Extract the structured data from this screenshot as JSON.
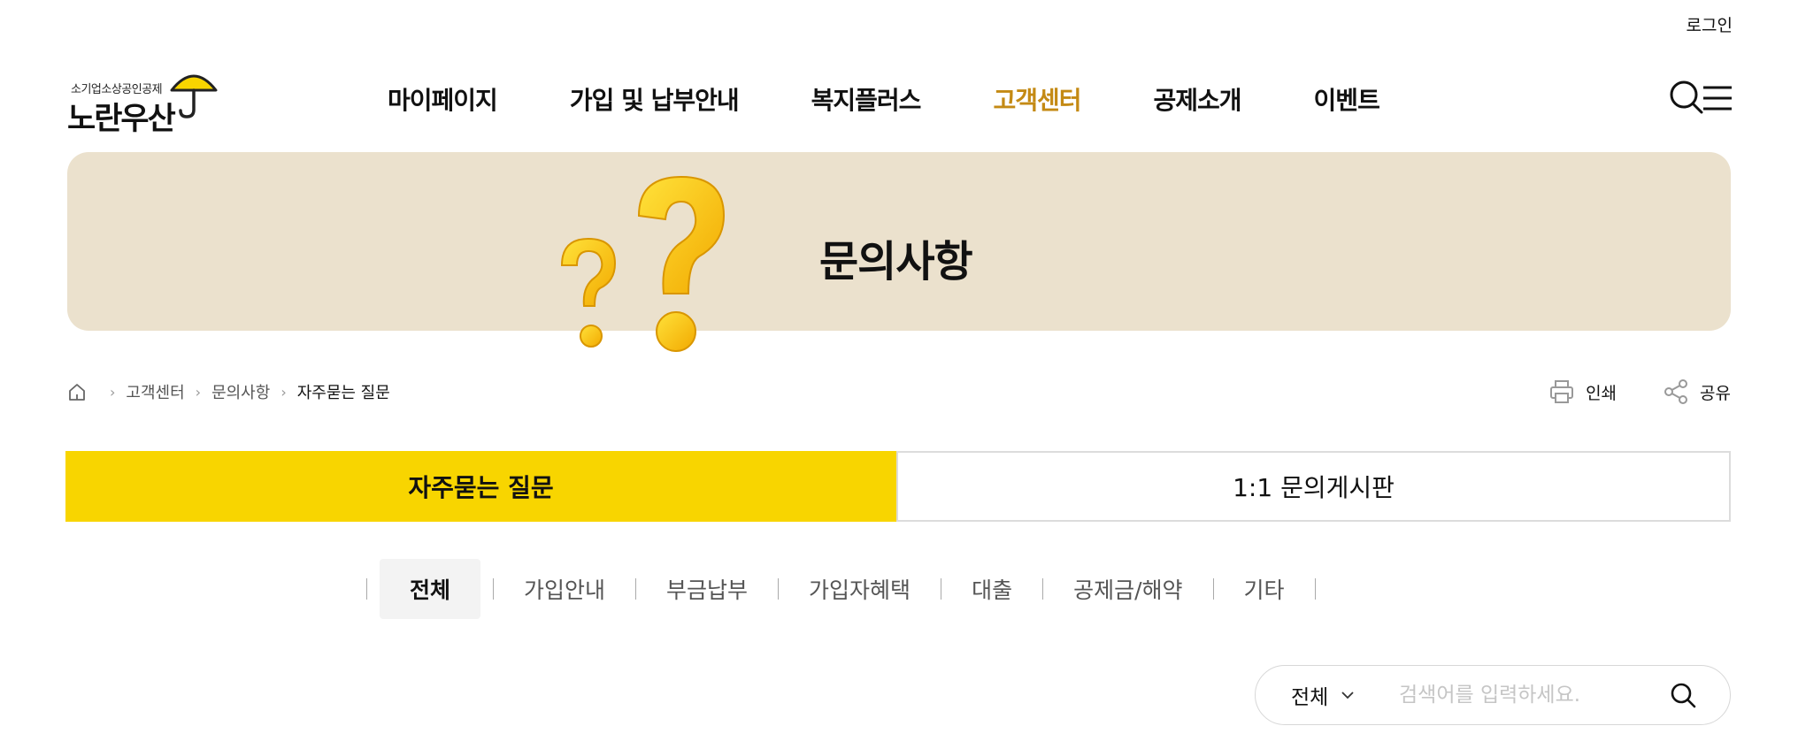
{
  "top_util": {
    "login_label": "로그인"
  },
  "logo": {
    "sub": "소기업소상공인공제",
    "main": "노란우산"
  },
  "gnb": {
    "items": [
      {
        "label": "마이페이지"
      },
      {
        "label": "가입 및 납부안내"
      },
      {
        "label": "복지플러스"
      },
      {
        "label": "고객센터",
        "active": true
      },
      {
        "label": "공제소개"
      },
      {
        "label": "이벤트"
      }
    ]
  },
  "banner": {
    "title": "문의사항"
  },
  "breadcrumb": {
    "items": [
      "고객센터",
      "문의사항",
      "자주묻는 질문"
    ]
  },
  "tools": {
    "print_label": "인쇄",
    "share_label": "공유"
  },
  "tabs": [
    {
      "label": "자주묻는 질문",
      "active": true
    },
    {
      "label": "1:1 문의게시판",
      "active": false
    }
  ],
  "categories": [
    {
      "label": "전체",
      "active": true
    },
    {
      "label": "가입안내"
    },
    {
      "label": "부금납부"
    },
    {
      "label": "가입자혜택"
    },
    {
      "label": "대출"
    },
    {
      "label": "공제금/해약"
    },
    {
      "label": "기타"
    }
  ],
  "search": {
    "select_value": "전체",
    "placeholder": "검색어를 입력하세요."
  },
  "colors": {
    "accent_yellow": "#f8d500",
    "active_nav": "#c48a14",
    "banner_bg": "#ebe1cd"
  },
  "icons": [
    "home-icon",
    "chevron-right-icon",
    "print-icon",
    "share-icon",
    "search-icon",
    "hamburger-menu-icon",
    "chevron-down-icon",
    "umbrella-icon"
  ]
}
